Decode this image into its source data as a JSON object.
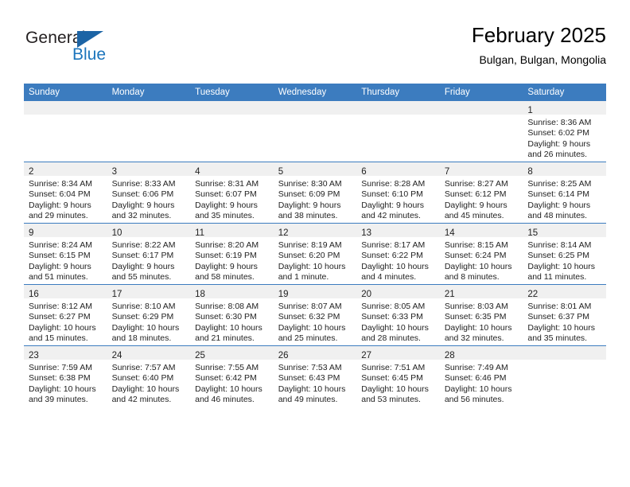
{
  "logo": {
    "word1": "General",
    "word2": "Blue",
    "triangle_color": "#1c64a5",
    "blue_color": "#1c75bc"
  },
  "header": {
    "title": "February 2025",
    "subtitle": "Bulgan, Bulgan, Mongolia"
  },
  "theme": {
    "header_bg": "#3c7cbf",
    "daynum_bg": "#f0f0f0",
    "row_divider": "#3c7cbf",
    "text": "#222222"
  },
  "weekdays": [
    "Sunday",
    "Monday",
    "Tuesday",
    "Wednesday",
    "Thursday",
    "Friday",
    "Saturday"
  ],
  "weeks": [
    [
      {
        "day": "",
        "sunrise": "",
        "sunset": "",
        "daylight1": "",
        "daylight2": "",
        "empty": true
      },
      {
        "day": "",
        "sunrise": "",
        "sunset": "",
        "daylight1": "",
        "daylight2": "",
        "empty": true
      },
      {
        "day": "",
        "sunrise": "",
        "sunset": "",
        "daylight1": "",
        "daylight2": "",
        "empty": true
      },
      {
        "day": "",
        "sunrise": "",
        "sunset": "",
        "daylight1": "",
        "daylight2": "",
        "empty": true
      },
      {
        "day": "",
        "sunrise": "",
        "sunset": "",
        "daylight1": "",
        "daylight2": "",
        "empty": true
      },
      {
        "day": "",
        "sunrise": "",
        "sunset": "",
        "daylight1": "",
        "daylight2": "",
        "empty": true
      },
      {
        "day": "1",
        "sunrise": "Sunrise: 8:36 AM",
        "sunset": "Sunset: 6:02 PM",
        "daylight1": "Daylight: 9 hours",
        "daylight2": "and 26 minutes.",
        "empty": false
      }
    ],
    [
      {
        "day": "2",
        "sunrise": "Sunrise: 8:34 AM",
        "sunset": "Sunset: 6:04 PM",
        "daylight1": "Daylight: 9 hours",
        "daylight2": "and 29 minutes.",
        "empty": false
      },
      {
        "day": "3",
        "sunrise": "Sunrise: 8:33 AM",
        "sunset": "Sunset: 6:06 PM",
        "daylight1": "Daylight: 9 hours",
        "daylight2": "and 32 minutes.",
        "empty": false
      },
      {
        "day": "4",
        "sunrise": "Sunrise: 8:31 AM",
        "sunset": "Sunset: 6:07 PM",
        "daylight1": "Daylight: 9 hours",
        "daylight2": "and 35 minutes.",
        "empty": false
      },
      {
        "day": "5",
        "sunrise": "Sunrise: 8:30 AM",
        "sunset": "Sunset: 6:09 PM",
        "daylight1": "Daylight: 9 hours",
        "daylight2": "and 38 minutes.",
        "empty": false
      },
      {
        "day": "6",
        "sunrise": "Sunrise: 8:28 AM",
        "sunset": "Sunset: 6:10 PM",
        "daylight1": "Daylight: 9 hours",
        "daylight2": "and 42 minutes.",
        "empty": false
      },
      {
        "day": "7",
        "sunrise": "Sunrise: 8:27 AM",
        "sunset": "Sunset: 6:12 PM",
        "daylight1": "Daylight: 9 hours",
        "daylight2": "and 45 minutes.",
        "empty": false
      },
      {
        "day": "8",
        "sunrise": "Sunrise: 8:25 AM",
        "sunset": "Sunset: 6:14 PM",
        "daylight1": "Daylight: 9 hours",
        "daylight2": "and 48 minutes.",
        "empty": false
      }
    ],
    [
      {
        "day": "9",
        "sunrise": "Sunrise: 8:24 AM",
        "sunset": "Sunset: 6:15 PM",
        "daylight1": "Daylight: 9 hours",
        "daylight2": "and 51 minutes.",
        "empty": false
      },
      {
        "day": "10",
        "sunrise": "Sunrise: 8:22 AM",
        "sunset": "Sunset: 6:17 PM",
        "daylight1": "Daylight: 9 hours",
        "daylight2": "and 55 minutes.",
        "empty": false
      },
      {
        "day": "11",
        "sunrise": "Sunrise: 8:20 AM",
        "sunset": "Sunset: 6:19 PM",
        "daylight1": "Daylight: 9 hours",
        "daylight2": "and 58 minutes.",
        "empty": false
      },
      {
        "day": "12",
        "sunrise": "Sunrise: 8:19 AM",
        "sunset": "Sunset: 6:20 PM",
        "daylight1": "Daylight: 10 hours",
        "daylight2": "and 1 minute.",
        "empty": false
      },
      {
        "day": "13",
        "sunrise": "Sunrise: 8:17 AM",
        "sunset": "Sunset: 6:22 PM",
        "daylight1": "Daylight: 10 hours",
        "daylight2": "and 4 minutes.",
        "empty": false
      },
      {
        "day": "14",
        "sunrise": "Sunrise: 8:15 AM",
        "sunset": "Sunset: 6:24 PM",
        "daylight1": "Daylight: 10 hours",
        "daylight2": "and 8 minutes.",
        "empty": false
      },
      {
        "day": "15",
        "sunrise": "Sunrise: 8:14 AM",
        "sunset": "Sunset: 6:25 PM",
        "daylight1": "Daylight: 10 hours",
        "daylight2": "and 11 minutes.",
        "empty": false
      }
    ],
    [
      {
        "day": "16",
        "sunrise": "Sunrise: 8:12 AM",
        "sunset": "Sunset: 6:27 PM",
        "daylight1": "Daylight: 10 hours",
        "daylight2": "and 15 minutes.",
        "empty": false
      },
      {
        "day": "17",
        "sunrise": "Sunrise: 8:10 AM",
        "sunset": "Sunset: 6:29 PM",
        "daylight1": "Daylight: 10 hours",
        "daylight2": "and 18 minutes.",
        "empty": false
      },
      {
        "day": "18",
        "sunrise": "Sunrise: 8:08 AM",
        "sunset": "Sunset: 6:30 PM",
        "daylight1": "Daylight: 10 hours",
        "daylight2": "and 21 minutes.",
        "empty": false
      },
      {
        "day": "19",
        "sunrise": "Sunrise: 8:07 AM",
        "sunset": "Sunset: 6:32 PM",
        "daylight1": "Daylight: 10 hours",
        "daylight2": "and 25 minutes.",
        "empty": false
      },
      {
        "day": "20",
        "sunrise": "Sunrise: 8:05 AM",
        "sunset": "Sunset: 6:33 PM",
        "daylight1": "Daylight: 10 hours",
        "daylight2": "and 28 minutes.",
        "empty": false
      },
      {
        "day": "21",
        "sunrise": "Sunrise: 8:03 AM",
        "sunset": "Sunset: 6:35 PM",
        "daylight1": "Daylight: 10 hours",
        "daylight2": "and 32 minutes.",
        "empty": false
      },
      {
        "day": "22",
        "sunrise": "Sunrise: 8:01 AM",
        "sunset": "Sunset: 6:37 PM",
        "daylight1": "Daylight: 10 hours",
        "daylight2": "and 35 minutes.",
        "empty": false
      }
    ],
    [
      {
        "day": "23",
        "sunrise": "Sunrise: 7:59 AM",
        "sunset": "Sunset: 6:38 PM",
        "daylight1": "Daylight: 10 hours",
        "daylight2": "and 39 minutes.",
        "empty": false
      },
      {
        "day": "24",
        "sunrise": "Sunrise: 7:57 AM",
        "sunset": "Sunset: 6:40 PM",
        "daylight1": "Daylight: 10 hours",
        "daylight2": "and 42 minutes.",
        "empty": false
      },
      {
        "day": "25",
        "sunrise": "Sunrise: 7:55 AM",
        "sunset": "Sunset: 6:42 PM",
        "daylight1": "Daylight: 10 hours",
        "daylight2": "and 46 minutes.",
        "empty": false
      },
      {
        "day": "26",
        "sunrise": "Sunrise: 7:53 AM",
        "sunset": "Sunset: 6:43 PM",
        "daylight1": "Daylight: 10 hours",
        "daylight2": "and 49 minutes.",
        "empty": false
      },
      {
        "day": "27",
        "sunrise": "Sunrise: 7:51 AM",
        "sunset": "Sunset: 6:45 PM",
        "daylight1": "Daylight: 10 hours",
        "daylight2": "and 53 minutes.",
        "empty": false
      },
      {
        "day": "28",
        "sunrise": "Sunrise: 7:49 AM",
        "sunset": "Sunset: 6:46 PM",
        "daylight1": "Daylight: 10 hours",
        "daylight2": "and 56 minutes.",
        "empty": false
      },
      {
        "day": "",
        "sunrise": "",
        "sunset": "",
        "daylight1": "",
        "daylight2": "",
        "empty": true
      }
    ]
  ]
}
